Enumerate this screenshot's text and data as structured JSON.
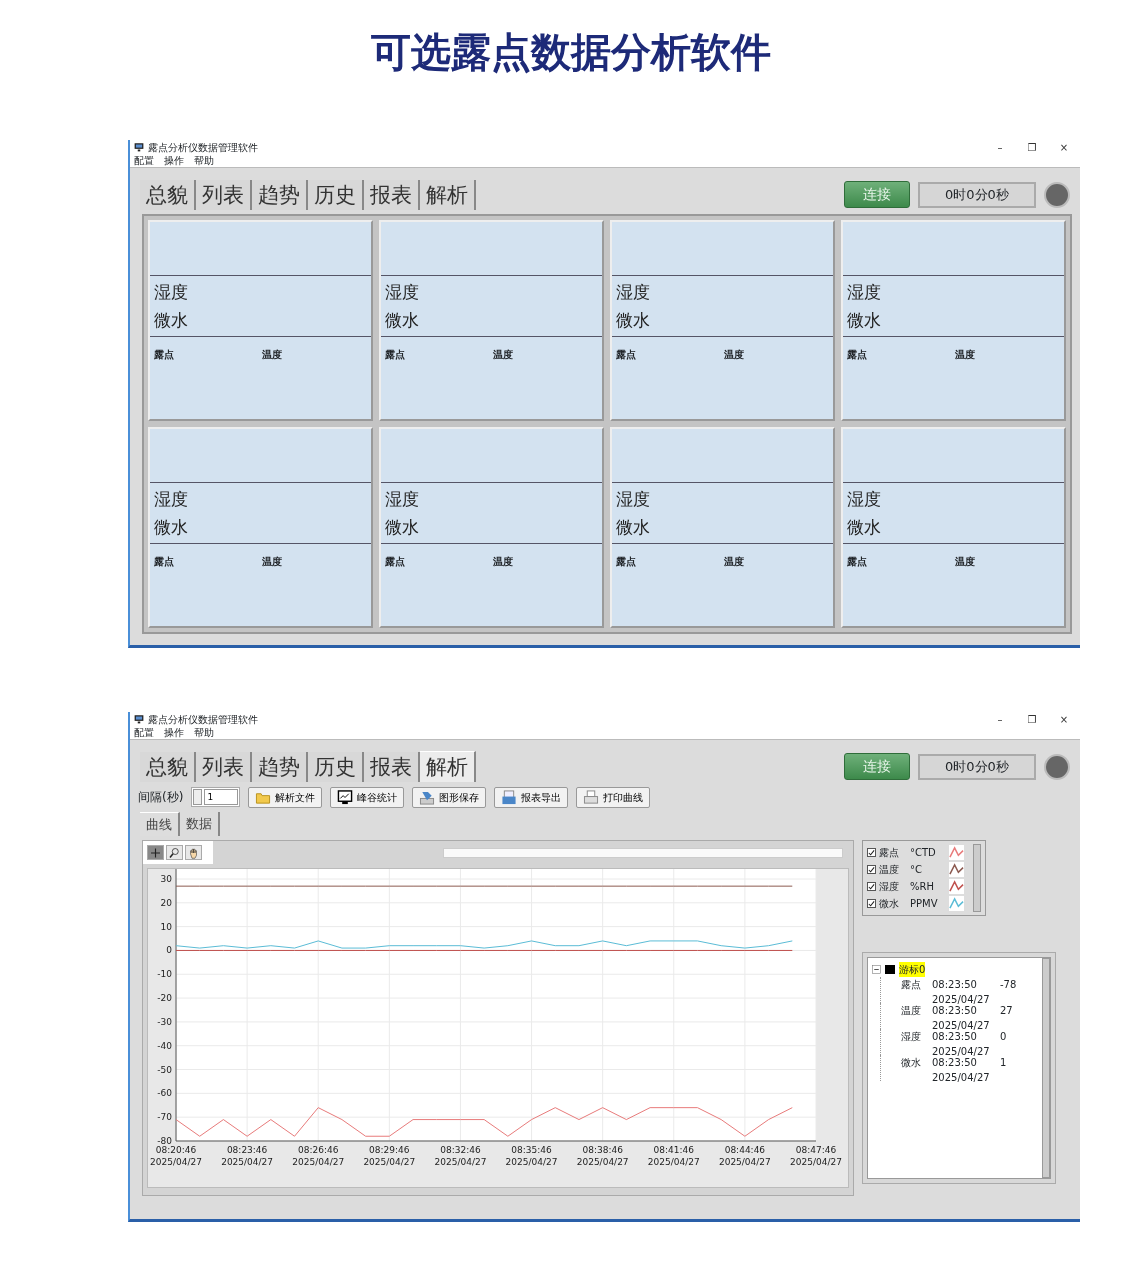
{
  "page_title": "可选露点数据分析软件",
  "windows": [
    {
      "kind": "overview",
      "title": "露点分析仪数据管理软件",
      "controls": [
        "–",
        "❐",
        "×"
      ],
      "menu": [
        "配置",
        "操作",
        "帮助"
      ],
      "tabs": [
        {
          "label": "总貌",
          "selected": false
        },
        {
          "label": "列表",
          "selected": false
        },
        {
          "label": "趋势",
          "selected": false
        },
        {
          "label": "历史",
          "selected": false
        },
        {
          "label": "报表",
          "selected": false
        },
        {
          "label": "解析",
          "selected": false
        }
      ],
      "connect_button": "连接",
      "timer": "0时0分0秒",
      "connected": false,
      "panels": [
        {
          "line_1": "湿度",
          "line_2": "微水",
          "label_1": "露点",
          "label_2": "温度"
        },
        {
          "line_1": "湿度",
          "line_2": "微水",
          "label_1": "露点",
          "label_2": "温度"
        },
        {
          "line_1": "湿度",
          "line_2": "微水",
          "label_1": "露点",
          "label_2": "温度"
        },
        {
          "line_1": "湿度",
          "line_2": "微水",
          "label_1": "露点",
          "label_2": "温度"
        },
        {
          "line_1": "湿度",
          "line_2": "微水",
          "label_1": "露点",
          "label_2": "温度"
        },
        {
          "line_1": "湿度",
          "line_2": "微水",
          "label_1": "露点",
          "label_2": "温度"
        },
        {
          "line_1": "湿度",
          "line_2": "微水",
          "label_1": "露点",
          "label_2": "温度"
        },
        {
          "line_1": "湿度",
          "line_2": "微水",
          "label_1": "露点",
          "label_2": "温度"
        }
      ]
    },
    {
      "kind": "analysis",
      "title": "露点分析仪数据管理软件",
      "controls": [
        "–",
        "❐",
        "×"
      ],
      "menu": [
        "配置",
        "操作",
        "帮助"
      ],
      "tabs": [
        {
          "label": "总貌",
          "selected": false
        },
        {
          "label": "列表",
          "selected": false
        },
        {
          "label": "趋势",
          "selected": false
        },
        {
          "label": "历史",
          "selected": false
        },
        {
          "label": "报表",
          "selected": false
        },
        {
          "label": "解析",
          "selected": true
        }
      ],
      "connect_button": "连接",
      "timer": "0时0分0秒",
      "connected": false,
      "interval_label": "间隔(秒)",
      "interval_value": "1",
      "toolbar": [
        {
          "kind": "folder",
          "label": "解析文件"
        },
        {
          "kind": "monitor",
          "label": "峰谷统计"
        },
        {
          "kind": "save",
          "label": "图形保存"
        },
        {
          "kind": "report",
          "label": "报表导出"
        },
        {
          "kind": "printer",
          "label": "打印曲线"
        }
      ],
      "subtabs": [
        {
          "label": "曲线",
          "selected": true
        },
        {
          "label": "数据",
          "selected": false
        }
      ],
      "graph_tools": [
        {
          "kind": "crosshair",
          "selected": true
        },
        {
          "kind": "zoom",
          "selected": false
        },
        {
          "kind": "pan",
          "selected": false
        }
      ],
      "chart_data": {
        "type": "line",
        "categories": [
          "08:20:46\n2025/04/27",
          null,
          null,
          "08:23:46\n2025/04/27",
          null,
          null,
          "08:26:46\n2025/04/27",
          null,
          null,
          "08:29:46\n2025/04/27",
          null,
          null,
          "08:32:46\n2025/04/27",
          null,
          null,
          "08:35:46\n2025/04/27",
          null,
          null,
          "08:38:46\n2025/04/27",
          null,
          null,
          "08:41:46\n2025/04/27",
          null,
          null,
          "08:44:46\n2025/04/27",
          null,
          null,
          "08:47:46\n2025/04/27"
        ],
        "ylim": [
          -80,
          30
        ],
        "yticks": [
          30,
          20,
          10,
          0,
          -10,
          -20,
          -30,
          -40,
          -50,
          -60,
          -70,
          -80
        ],
        "series": [
          {
            "name": "露点",
            "color": "#e87b7b",
            "values": [
              -71,
              -78,
              -71,
              -78,
              -71,
              -78,
              -66,
              -71,
              -78,
              -78,
              -71,
              -71,
              -71,
              -71,
              -78,
              -71,
              -66,
              -71,
              -66,
              -71,
              -66,
              -66,
              -66,
              -71,
              -78,
              -71,
              -66,
              null
            ]
          },
          {
            "name": "温度",
            "color": "#8c5a50",
            "values": [
              27,
              27,
              27,
              27,
              27,
              27,
              27,
              27,
              27,
              27,
              27,
              27,
              27,
              27,
              27,
              27,
              27,
              27,
              27,
              27,
              27,
              27,
              27,
              27,
              27,
              27,
              27,
              null
            ]
          },
          {
            "name": "湿度",
            "color": "#c0504d",
            "values": [
              0,
              0,
              0,
              0,
              0,
              0,
              0,
              0,
              0,
              0,
              0,
              0,
              0,
              0,
              0,
              0,
              0,
              0,
              0,
              0,
              0,
              0,
              0,
              0,
              0,
              0,
              0,
              null
            ]
          },
          {
            "name": "微水",
            "color": "#5bbcd6",
            "values": [
              2,
              1,
              2,
              1,
              2,
              1,
              4,
              1,
              1,
              2,
              2,
              2,
              2,
              1,
              2,
              4,
              2,
              2,
              4,
              2,
              4,
              4,
              4,
              2,
              1,
              2,
              4,
              null
            ]
          }
        ],
        "grid": true
      },
      "legend": [
        {
          "unit": "°CTD",
          "checked": true
        },
        {
          "unit": "°C",
          "checked": true
        },
        {
          "unit": "%RH",
          "checked": true
        },
        {
          "unit": "PPMV",
          "checked": true
        }
      ],
      "cursor_tree": {
        "label": "游标0",
        "expanded": true,
        "children": [
          {
            "name": "露点",
            "time": "08:23:50",
            "date": "2025/04/27",
            "value": "-78"
          },
          {
            "name": "温度",
            "time": "08:23:50",
            "date": "2025/04/27",
            "value": "27"
          },
          {
            "name": "湿度",
            "time": "08:23:50",
            "date": "2025/04/27",
            "value": "0"
          },
          {
            "name": "微水",
            "time": "08:23:50",
            "date": "2025/04/27",
            "value": "1"
          }
        ]
      }
    }
  ]
}
